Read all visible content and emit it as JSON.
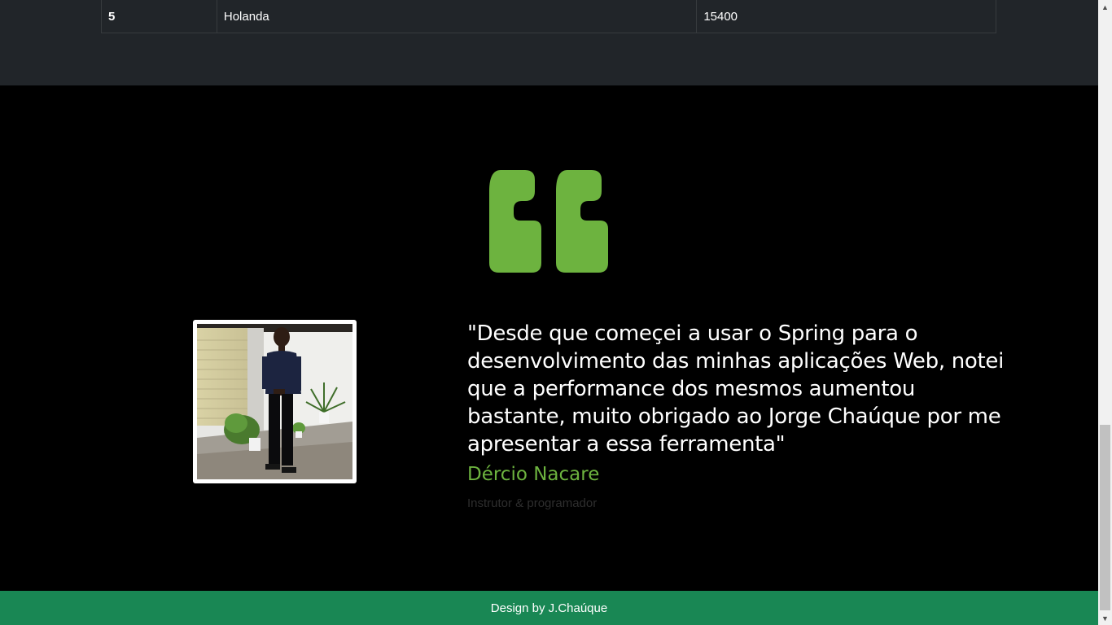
{
  "table": {
    "rows": [
      {
        "number": "5",
        "country": "Holanda",
        "value": "15400"
      }
    ]
  },
  "testimonial": {
    "quote_icon": "quote-left-icon",
    "photo_alt": "Dércio Nacare",
    "quote": "\"Desde que começei a usar o Spring para o desenvolvimento das minhas aplicações Web, notei que a performance dos mesmos aumentou bastante, muito obrigado ao Jorge Chaúque por me apresentar a essa ferramenta\"",
    "author": "Dércio Nacare",
    "role": "Instrutor & programador"
  },
  "footer": {
    "text": "Design by J.Chaúque"
  },
  "colors": {
    "table_bg": "#212529",
    "accent_green": "#6db33f",
    "footer_bg": "#198754",
    "page_bg": "#000000"
  },
  "scrollbar": {
    "up_icon": "chevron-up-icon",
    "down_icon": "chevron-down-icon"
  }
}
